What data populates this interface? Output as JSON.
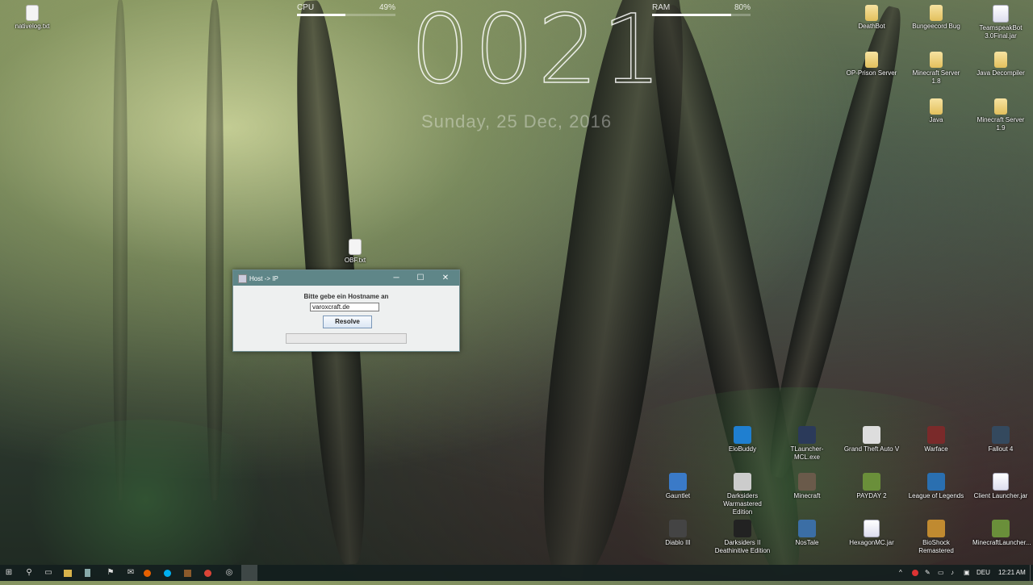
{
  "desktop": {
    "meters": {
      "cpu": {
        "label": "CPU",
        "value": "49%",
        "fraction": 0.49
      },
      "ram": {
        "label": "RAM",
        "value": "80%",
        "fraction": 0.8
      }
    },
    "clock": {
      "time": "0021",
      "date": "Sunday, 25 Dec, 2016"
    },
    "icons_left": [
      {
        "label": "nativelog.txt"
      },
      {
        "label": "OBF.txt"
      }
    ],
    "icons_right": [
      {
        "label": "DeathBot"
      },
      {
        "label": "Bungeecord Bug"
      },
      {
        "label": "TeamspeakBot 3.0Final.jar"
      },
      {
        "label": "OP-Prison Server"
      },
      {
        "label": "Minecraft Server 1.8"
      },
      {
        "label": "Java Decompiler"
      },
      {
        "label": "Java"
      },
      {
        "label": "Minecraft Server 1.9"
      },
      {
        "label": "EloBuddy"
      },
      {
        "label": "TLauncher-MCL.exe"
      },
      {
        "label": "Grand Theft Auto V"
      },
      {
        "label": "Warface"
      },
      {
        "label": "Fallout 4"
      },
      {
        "label": "Gauntlet"
      },
      {
        "label": "Darksiders Warmastered Edition"
      },
      {
        "label": "Minecraft"
      },
      {
        "label": "PAYDAY 2"
      },
      {
        "label": "League of Legends"
      },
      {
        "label": "Client Launcher.jar"
      },
      {
        "label": "Diablo III"
      },
      {
        "label": "Darksiders II Deathinitive Edition"
      },
      {
        "label": "NosTale"
      },
      {
        "label": "HexagonMC.jar"
      },
      {
        "label": "BioShock Remastered"
      },
      {
        "label": "MinecraftLauncher..."
      }
    ]
  },
  "window": {
    "title": "Host -> IP",
    "minimize": "─",
    "maximize": "☐",
    "close": "✕",
    "prompt": "Bitte gebe ein Hostname an",
    "host_value": "varoxcraft.de",
    "resolve_label": "Resolve",
    "progress_fraction": 0
  },
  "taskbar": {
    "start": "⊞",
    "search": "⚲",
    "taskview": "▭",
    "language": "DEU",
    "time": "12:21 AM",
    "tray_arrow": "^"
  },
  "colors": {
    "titlebar": "#5f8688",
    "taskbar": "#141e1e"
  }
}
